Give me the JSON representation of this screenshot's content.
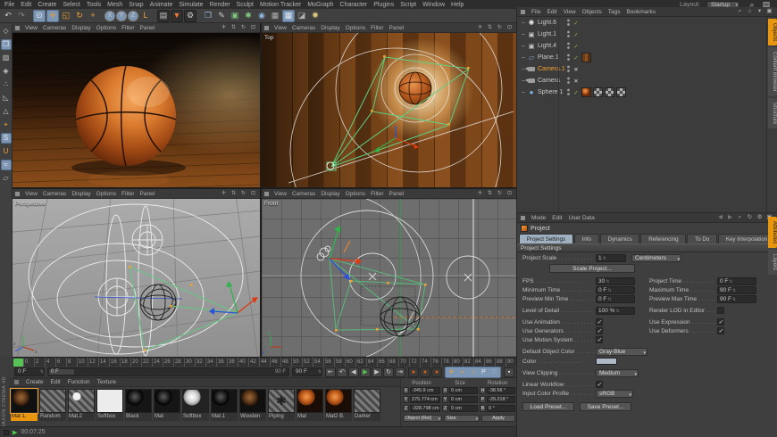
{
  "menubar": {
    "items": [
      "File",
      "Edit",
      "Create",
      "Select",
      "Tools",
      "Mesh",
      "Snap",
      "Animate",
      "Simulate",
      "Render",
      "Sculpt",
      "Motion Tracker",
      "MoGraph",
      "Character",
      "Plugins",
      "Script",
      "Window",
      "Help"
    ],
    "layout_label": "Layout:",
    "layout_value": "Startup",
    "right_icons": [
      {
        "name": "search-icon",
        "glyph": "⌕"
      },
      {
        "name": "interface-icon",
        "glyph": "▤"
      }
    ]
  },
  "toolbar": {
    "icons": [
      {
        "name": "undo-icon",
        "glyph": "↶",
        "c": "#d0d0d0"
      },
      {
        "name": "redo-icon",
        "glyph": "↷",
        "c": "#8a8a8a"
      },
      {
        "name": "divider"
      },
      {
        "name": "live-selection-icon",
        "glyph": "⊙",
        "c": "#ececec",
        "hl": true
      },
      {
        "name": "move-tool-icon",
        "glyph": "✛",
        "c": "#f0a030",
        "hl": true
      },
      {
        "name": "scale-tool-icon",
        "glyph": "◱",
        "c": "#f0a030"
      },
      {
        "name": "rotate-tool-icon",
        "glyph": "↻",
        "c": "#f0a030"
      },
      {
        "name": "last-tool-icon",
        "glyph": "+",
        "c": "#f0a030"
      },
      {
        "name": "divider"
      },
      {
        "name": "lock-x-axis-icon",
        "glyph": "X",
        "circle": true,
        "hl": true
      },
      {
        "name": "lock-y-axis-icon",
        "glyph": "Y",
        "circle": true,
        "hl": true
      },
      {
        "name": "lock-z-axis-icon",
        "glyph": "Z",
        "circle": true,
        "hl": true
      },
      {
        "name": "coordinate-system-icon",
        "glyph": "L",
        "c": "#f0a030"
      },
      {
        "name": "divider"
      },
      {
        "name": "render-view-icon",
        "glyph": "▤",
        "c": "#c8c8c8",
        "dark": true
      },
      {
        "name": "render-region-icon",
        "glyph": "▼",
        "c": "#f07830",
        "dark": true
      },
      {
        "name": "render-settings-icon",
        "glyph": "⚙",
        "c": "#c8c8c8",
        "dark": true
      },
      {
        "name": "divider"
      },
      {
        "name": "add-cube-icon",
        "glyph": "❒",
        "c": "#9fc0e0"
      },
      {
        "name": "add-spline-icon",
        "glyph": "✎",
        "c": "#cccccc"
      },
      {
        "name": "subdivision-surface-icon",
        "glyph": "▣",
        "c": "#7ec87e"
      },
      {
        "name": "deformer-icon",
        "glyph": "✱",
        "c": "#7ec87e"
      },
      {
        "name": "environment-icon",
        "glyph": "◉",
        "c": "#8fb8e0"
      },
      {
        "name": "camera-object-icon",
        "glyph": "▦",
        "c": "#b0b0b0"
      },
      {
        "name": "display-mode-icon",
        "glyph": "▦",
        "c": "#dfe8f0",
        "hl": true
      },
      {
        "name": "clapboard-icon",
        "glyph": "◪",
        "c": "#b0b0b0"
      },
      {
        "name": "light-object-icon",
        "glyph": "✺",
        "c": "#e8d080"
      }
    ]
  },
  "palette": {
    "icons": [
      {
        "name": "make-editable-icon",
        "glyph": "◇",
        "c": "#c8c8c8"
      },
      {
        "name": "model-mode-icon",
        "glyph": "❒",
        "c": "#eaeaea",
        "hl": true
      },
      {
        "name": "texture-mode-icon",
        "glyph": "▨",
        "c": "#c8c8c8"
      },
      {
        "name": "workplane-mode-icon",
        "glyph": "◈",
        "c": "#c8c8c8"
      },
      {
        "name": "points-mode-icon",
        "glyph": "∴",
        "c": "#c8c8c8"
      },
      {
        "name": "edges-mode-icon",
        "glyph": "◺",
        "c": "#c8c8c8"
      },
      {
        "name": "polygons-mode-icon",
        "glyph": "△",
        "c": "#c8c8c8"
      },
      {
        "name": "enable-axis-icon",
        "glyph": "⌖",
        "c": "#f0a030"
      },
      {
        "name": "texture-axis-icon",
        "glyph": "S",
        "c": "#e8e8e8",
        "hl": true
      },
      {
        "name": "magnet-tool-icon",
        "glyph": "U",
        "c": "#f0a030"
      },
      {
        "name": "snap-icon",
        "glyph": "≈",
        "c": "#eaeaea",
        "hl": true
      },
      {
        "name": "locked-workplane-icon",
        "glyph": "▱",
        "c": "#c8c8c8"
      }
    ]
  },
  "viewports": {
    "menu": [
      "View",
      "Cameras",
      "Display",
      "Options",
      "Filter",
      "Panel"
    ],
    "nav": [
      {
        "name": "pan-view-icon",
        "glyph": "✛"
      },
      {
        "name": "zoom-view-icon",
        "glyph": "⇅"
      },
      {
        "name": "rotate-view-icon",
        "glyph": "↻"
      },
      {
        "name": "maximize-view-icon",
        "glyph": "⊡"
      }
    ],
    "top_right_label": "Top",
    "bottom_left_label": "Perspective",
    "bottom_right_label": "Front"
  },
  "timeline": {
    "ticks": [
      0,
      2,
      4,
      6,
      8,
      10,
      12,
      14,
      16,
      18,
      20,
      22,
      24,
      26,
      28,
      30,
      32,
      34,
      36,
      38,
      40,
      42,
      44,
      46,
      48,
      50,
      52,
      54,
      56,
      58,
      60,
      62,
      64,
      66,
      68,
      70,
      72,
      74,
      76,
      78,
      80,
      82,
      84,
      86,
      88,
      90
    ],
    "current_frame": "0 F",
    "range_start": "0 F",
    "range_end_label": "90 F",
    "end_frame": "90 F"
  },
  "transport": {
    "playback": [
      {
        "name": "goto-start-button",
        "glyph": "⇤"
      },
      {
        "name": "previous-key-button",
        "glyph": "↶"
      },
      {
        "name": "previous-frame-button",
        "glyph": "◀"
      },
      {
        "name": "play-button",
        "glyph": "▶",
        "c": "#4ec94e"
      },
      {
        "name": "next-frame-button",
        "glyph": "▶"
      },
      {
        "name": "loop-button",
        "glyph": "↻"
      },
      {
        "name": "goto-end-button",
        "glyph": "⇥"
      }
    ],
    "records": [
      {
        "name": "record-keyframe-button",
        "glyph": "●",
        "c": "#e05a10",
        "dark": true
      },
      {
        "name": "autokeying-button",
        "glyph": "●",
        "c": "#e05a10",
        "dark": true
      },
      {
        "name": "record-options-button",
        "glyph": "●",
        "c": "#e05a10",
        "dark": true
      }
    ],
    "toggles": [
      {
        "name": "record-position-icon",
        "glyph": "✛",
        "c": "#f0a030"
      },
      {
        "name": "record-scale-icon",
        "glyph": "▪",
        "c": "#f0a030"
      },
      {
        "name": "record-rotation-icon",
        "glyph": "○",
        "c": "#f0a030"
      },
      {
        "name": "record-parameter-icon",
        "glyph": "P",
        "c": "#ececec"
      },
      {
        "name": "record-pla-icon",
        "glyph": "∷",
        "c": "#d0d0d0"
      }
    ],
    "end_icons": [
      {
        "name": "keyframe-selection-icon",
        "glyph": "▪",
        "c": "#ececec",
        "hl": true
      }
    ]
  },
  "materials": {
    "menu": [
      "Create",
      "Edit",
      "Function",
      "Texture"
    ],
    "items": [
      {
        "label": "Mat 1.",
        "type": "wood-sphere",
        "selected": true
      },
      {
        "label": "Random",
        "type": "hatch"
      },
      {
        "label": "Mat.2",
        "type": "hatch-sphere"
      },
      {
        "label": "Softbox",
        "type": "white"
      },
      {
        "label": "Black",
        "type": "black-sphere"
      },
      {
        "label": "Mat",
        "type": "black-sphere"
      },
      {
        "label": "Softbox",
        "type": "white-sphere"
      },
      {
        "label": "Mat.1",
        "type": "black-sphere"
      },
      {
        "label": "Wooden",
        "type": "wood-sphere"
      },
      {
        "label": "Piping",
        "type": "hatch-star",
        "overlay": "✱"
      },
      {
        "label": "Mat",
        "type": "basketball"
      },
      {
        "label": "Mat2 B.",
        "type": "basketball"
      },
      {
        "label": "Darker",
        "type": "hatch"
      }
    ]
  },
  "coordinates": {
    "groups": [
      {
        "title": "Position",
        "rows": [
          [
            "X",
            "-345.9 cm"
          ],
          [
            "Y",
            "275.774 cm"
          ],
          [
            "Z",
            "-328.798 cm"
          ]
        ]
      },
      {
        "title": "Size",
        "rows": [
          [
            "X",
            "0 cm"
          ],
          [
            "Y",
            "0 cm"
          ],
          [
            "Z",
            "0 cm"
          ]
        ]
      },
      {
        "title": "Rotation",
        "rows": [
          [
            "H",
            "-38.56 °"
          ],
          [
            "P",
            "-29.218 °"
          ],
          [
            "B",
            "0 °"
          ]
        ]
      }
    ],
    "mode_dropdown": "Object (Rel)",
    "size_dropdown": "Size",
    "apply_button": "Apply"
  },
  "statusbar": {
    "time": "00:07:25"
  },
  "branding": {
    "vertical_text": "MAXON CINEMA 4D"
  },
  "object_manager": {
    "menu": [
      "File",
      "Edit",
      "View",
      "Objects",
      "Tags",
      "Bookmarks"
    ],
    "right_icons": [
      {
        "name": "search-icon",
        "glyph": "⌕"
      },
      {
        "name": "home-icon",
        "glyph": "⌂"
      },
      {
        "name": "collapse-icon",
        "glyph": "▾"
      },
      {
        "name": "panel-icon",
        "glyph": "▣"
      }
    ],
    "side_tabs": [
      "Objects",
      "Content Browser",
      "Structure"
    ],
    "active_side_tab": "Objects",
    "check_glyph": "✓",
    "cross_glyph": "✕",
    "objects": [
      {
        "name": "Light.6",
        "icon": "light",
        "state": "check"
      },
      {
        "name": "Light.1",
        "icon": "light2",
        "state": "check"
      },
      {
        "name": "Light.4",
        "icon": "light2",
        "state": "check"
      },
      {
        "name": "Plane.1",
        "icon": "plane",
        "state": "check",
        "tags": [
          "floor"
        ]
      },
      {
        "name": "Camera.1",
        "icon": "camera",
        "state": "cross",
        "selected": true
      },
      {
        "name": "Camera",
        "icon": "camera",
        "state": "cross"
      },
      {
        "name": "Sphere.1",
        "icon": "sphere",
        "state": "check",
        "tags": [
          "basketball",
          "checker",
          "checker",
          "checker"
        ]
      }
    ]
  },
  "attributes": {
    "menu": [
      "Mode",
      "Edit",
      "User Data"
    ],
    "right_icons": [
      {
        "name": "back-icon",
        "glyph": "◀",
        "c": "#777777"
      },
      {
        "name": "forward-icon",
        "glyph": "▶",
        "c": "#777777"
      },
      {
        "name": "search-icon",
        "glyph": "⌕"
      },
      {
        "name": "history-icon",
        "glyph": "↻"
      },
      {
        "name": "gear-icon",
        "glyph": "⚙"
      },
      {
        "name": "panel-icon",
        "glyph": "▣"
      }
    ],
    "title": "Project",
    "tabs": [
      "Project Settings",
      "Info",
      "Dynamics",
      "Referencing",
      "To Do",
      "Key Interpolation"
    ],
    "active_tab": "Project Settings",
    "section": "Project Settings",
    "side_tabs": [
      "Attributes",
      "Layers"
    ],
    "active_side_tab": "Attributes",
    "check_glyph": "✓",
    "fields": {
      "project_scale_label": "Project Scale",
      "project_scale_value": "1",
      "project_scale_unit": "Centimeters",
      "scale_project_button": "Scale Project...",
      "fps_label": "FPS",
      "fps_value": "30",
      "project_time_label": "Project Time",
      "project_time_value": "0 F",
      "minimum_time_label": "Minimum Time",
      "minimum_time_value": "0 F",
      "maximum_time_label": "Maximum Time",
      "maximum_time_value": "90 F",
      "preview_min_label": "Preview Min Time",
      "preview_min_value": "0 F",
      "preview_max_label": "Preview Max Time",
      "preview_max_value": "90 F",
      "lod_label": "Level of Detail",
      "lod_value": "100 %",
      "render_lod_label": "Render LOD in Editor",
      "use_animation_label": "Use Animation",
      "use_expression_label": "Use Expression",
      "use_generators_label": "Use Generators",
      "use_deformers_label": "Use Deformers",
      "use_motion_label": "Use Motion System",
      "default_color_label": "Default Object Color",
      "default_color_value": "Gray-Blue",
      "color_label": "Color",
      "view_clipping_label": "View Clipping",
      "view_clipping_value": "Medium",
      "linear_workflow_label": "Linear Workflow",
      "input_profile_label": "Input Color Profile",
      "input_profile_value": "sRGB",
      "load_preset_button": "Load Preset...",
      "save_preset_button": "Save Preset..."
    }
  }
}
